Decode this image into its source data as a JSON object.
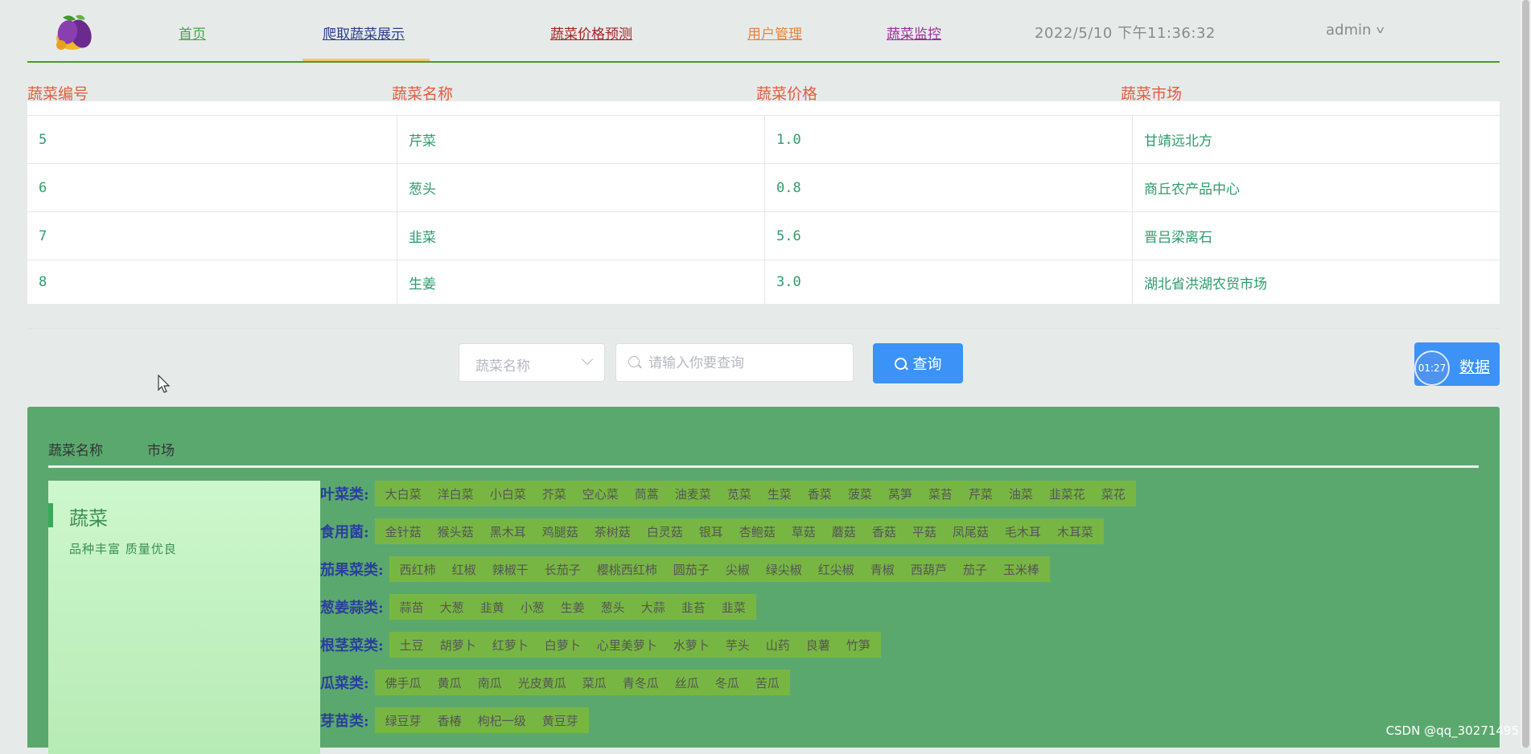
{
  "nav": {
    "items": [
      {
        "label": "首页",
        "color": "#49a349"
      },
      {
        "label": "爬取蔬菜展示",
        "color": "#2c3e8c"
      },
      {
        "label": "蔬菜价格预测",
        "color": "#a72222"
      },
      {
        "label": "用户管理",
        "color": "#e8843c"
      },
      {
        "label": "蔬菜监控",
        "color": "#9b2c9b"
      }
    ],
    "datetime": "2022/5/10 下午11:36:32",
    "user": "admin"
  },
  "table": {
    "headers": [
      "蔬菜编号",
      "蔬菜名称",
      "蔬菜价格",
      "蔬菜市场"
    ],
    "rows": [
      [
        "5",
        "芹菜",
        "1.0",
        "甘靖远北方"
      ],
      [
        "6",
        "葱头",
        "0.8",
        "商丘农产品中心"
      ],
      [
        "7",
        "韭菜",
        "5.6",
        "晋吕梁离石"
      ],
      [
        "8",
        "生姜",
        "3.0",
        "湖北省洪湖农贸市场"
      ]
    ]
  },
  "search": {
    "select_placeholder": "蔬菜名称",
    "input_placeholder": "请输入你要查询",
    "query_label": "查询",
    "data_button_label": "数据",
    "recording_time": "01:27"
  },
  "panel": {
    "tabs": [
      "蔬菜名称",
      "市场"
    ],
    "card": {
      "title": "蔬菜",
      "slogan": "品种丰富  质量优良"
    },
    "groups": [
      {
        "label": "叶菜类:",
        "tags": [
          "大白菜",
          "洋白菜",
          "小白菜",
          "芥菜",
          "空心菜",
          "茼蒿",
          "油麦菜",
          "苋菜",
          "生菜",
          "香菜",
          "菠菜",
          "莴笋",
          "菜苔",
          "芹菜",
          "油菜",
          "韭菜花",
          "菜花"
        ]
      },
      {
        "label": "食用菌:",
        "tags": [
          "金针菇",
          "猴头菇",
          "黑木耳",
          "鸡腿菇",
          "茶树菇",
          "白灵菇",
          "银耳",
          "杏鲍菇",
          "草菇",
          "蘑菇",
          "香菇",
          "平菇",
          "凤尾菇",
          "毛木耳",
          "木耳菜"
        ]
      },
      {
        "label": "茄果菜类:",
        "tags": [
          "西红柿",
          "红椒",
          "辣椒干",
          "长茄子",
          "樱桃西红柿",
          "圆茄子",
          "尖椒",
          "绿尖椒",
          "红尖椒",
          "青椒",
          "西葫芦",
          "茄子",
          "玉米棒"
        ]
      },
      {
        "label": "葱姜蒜类:",
        "tags": [
          "蒜苗",
          "大葱",
          "韭黄",
          "小葱",
          "生姜",
          "葱头",
          "大蒜",
          "韭苔",
          "韭菜"
        ]
      },
      {
        "label": "根茎菜类:",
        "tags": [
          "土豆",
          "胡萝卜",
          "红萝卜",
          "白萝卜",
          "心里美萝卜",
          "水萝卜",
          "芋头",
          "山药",
          "良薯",
          "竹笋"
        ]
      },
      {
        "label": "瓜菜类:",
        "tags": [
          "佛手瓜",
          "黄瓜",
          "南瓜",
          "光皮黄瓜",
          "菜瓜",
          "青冬瓜",
          "丝瓜",
          "冬瓜",
          "苦瓜"
        ]
      },
      {
        "label": "芽苗类:",
        "tags": [
          "绿豆芽",
          "香椿",
          "枸杞一级",
          "黄豆芽"
        ]
      }
    ]
  },
  "watermark": "CSDN @qq_30271495"
}
